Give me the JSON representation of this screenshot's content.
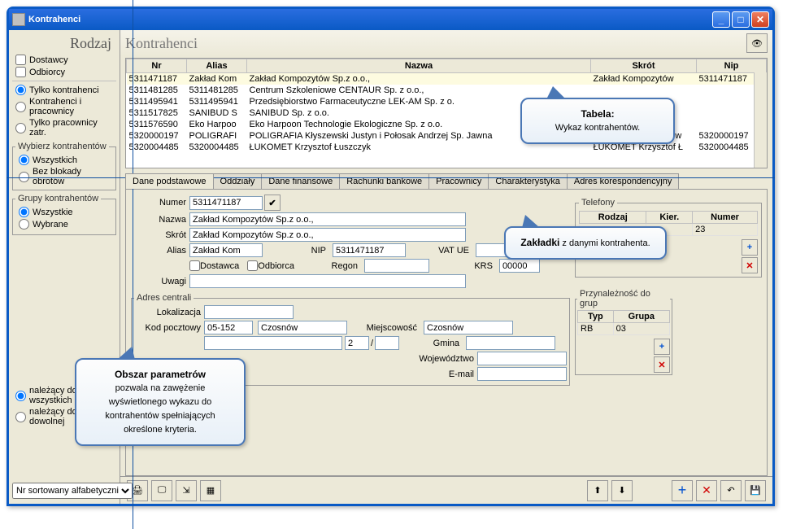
{
  "titlebar": {
    "title": "Kontrahenci"
  },
  "sidebar": {
    "heading": "Rodzaj",
    "dostawcy": "Dostawcy",
    "odbiorcy": "Odbiorcy",
    "r1": "Tylko kontrahenci",
    "r2": "Kontrahenci i pracownicy",
    "r3": "Tylko pracownicy zatr.",
    "fs_wyb": "Wybierz kontrahentów",
    "wyb_r1": "Wszystkich",
    "wyb_r2": "Bez blokady obrotów",
    "fs_grp": "Grupy kontrahentów",
    "grp_r1": "Wszystkie",
    "grp_r2": "Wybrane",
    "nal1": "należący do wszystkich",
    "nal2": "należący do dowolnej",
    "sort": "Nr sortowany alfabetycznie"
  },
  "list": {
    "heading": "Kontrahenci",
    "cols": {
      "nr": "Nr",
      "alias": "Alias",
      "nazwa": "Nazwa",
      "skrot": "Skrót",
      "nip": "Nip"
    },
    "rows": [
      {
        "nr": "5311471187",
        "alias": "Zakład Kom",
        "nazwa": "Zakład Kompozytów Sp.z o.o.,",
        "skrot": "Zakład Kompozytów",
        "nip": "5311471187"
      },
      {
        "nr": "5311481285",
        "alias": "5311481285",
        "nazwa": "Centrum Szkoleniowe CENTAUR Sp. z o.o.,",
        "skrot": "",
        "nip": ""
      },
      {
        "nr": "5311495941",
        "alias": "5311495941",
        "nazwa": "Przedsiębiorstwo Farmaceutyczne LEK-AM Sp. z o.",
        "skrot": "",
        "nip": ""
      },
      {
        "nr": "5311517825",
        "alias": "SANIBUD S",
        "nazwa": "SANIBUD Sp. z o.o.",
        "skrot": "",
        "nip": ""
      },
      {
        "nr": "5311576590",
        "alias": "Eko Harpoo",
        "nazwa": "Eko Harpoon Technologie Ekologiczne Sp. z o.o.",
        "skrot": "",
        "nip": ""
      },
      {
        "nr": "5320000197",
        "alias": "POLIGRAFI",
        "nazwa": "POLIGRAFIA Kłyszewski Justyn i Połosak Andrzej Sp. Jawna",
        "skrot": "POLIGRAFIA Kłyszew",
        "nip": "5320000197"
      },
      {
        "nr": "5320004485",
        "alias": "5320004485",
        "nazwa": "ŁUKOMET Krzysztof Łuszczyk",
        "skrot": "ŁUKOMET Krzysztof Ł",
        "nip": "5320004485"
      }
    ]
  },
  "tabs": {
    "t0": "Dane podstawowe",
    "t1": "Oddziały",
    "t2": "Dane finansowe",
    "t3": "Rachunki bankowe",
    "t4": "Pracownicy",
    "t5": "Charakterystyka",
    "t6": "Adres korespondencyjny"
  },
  "form": {
    "lbl_numer": "Numer",
    "numer": "5311471187",
    "lbl_nazwa": "Nazwa",
    "nazwa": "Zakład Kompozytów Sp.z o.o.,",
    "lbl_skrot": "Skrót",
    "skrot": "Zakład Kompozytów Sp.z o.o.,",
    "lbl_alias": "Alias",
    "alias": "Zakład Kom",
    "lbl_nip": "NIP",
    "nip": "5311471187",
    "lbl_vatue": "VAT UE",
    "vatue": "",
    "lbl_dostawca": "Dostawca",
    "lbl_odbiorca": "Odbiorca",
    "lbl_regon": "Regon",
    "regon": "",
    "lbl_krs": "KRS",
    "krs": "00000",
    "lbl_uwagi": "Uwagi",
    "uwagi": ""
  },
  "tel": {
    "legend": "Telefony",
    "c_rodzaj": "Rodzaj",
    "c_kier": "Kier.",
    "c_numer": "Numer",
    "val": "23"
  },
  "addr": {
    "legend": "Adres centrali",
    "lbl_lok": "Lokalizacja",
    "lok": "",
    "lbl_kod": "Kod pocztowy",
    "kod": "05-152",
    "miasto": "Czosnów",
    "lbl_miej": "Miejscowość",
    "miej": "Czosnów",
    "dom": "2",
    "lok2": "/",
    "lbl_gmina": "Gmina",
    "gmina": "",
    "lbl_woj": "Województwo",
    "woj": "",
    "lbl_email": "E-mail",
    "email": ""
  },
  "grp": {
    "legend": "Przynależność do grup",
    "c_typ": "Typ",
    "c_grupa": "Grupa",
    "typ": "RB",
    "grupa": "03"
  },
  "callouts": {
    "c1a": "Tabela:",
    "c1b": "Wykaz kontrahentów.",
    "c2a": "Zakładki",
    "c2b": " z danymi kontrahenta.",
    "c3a": "Obszar parametrów",
    "c3b": "pozwala na zawężenie wyświetlonego wykazu do kontrahentów spełniających określone kryteria."
  }
}
